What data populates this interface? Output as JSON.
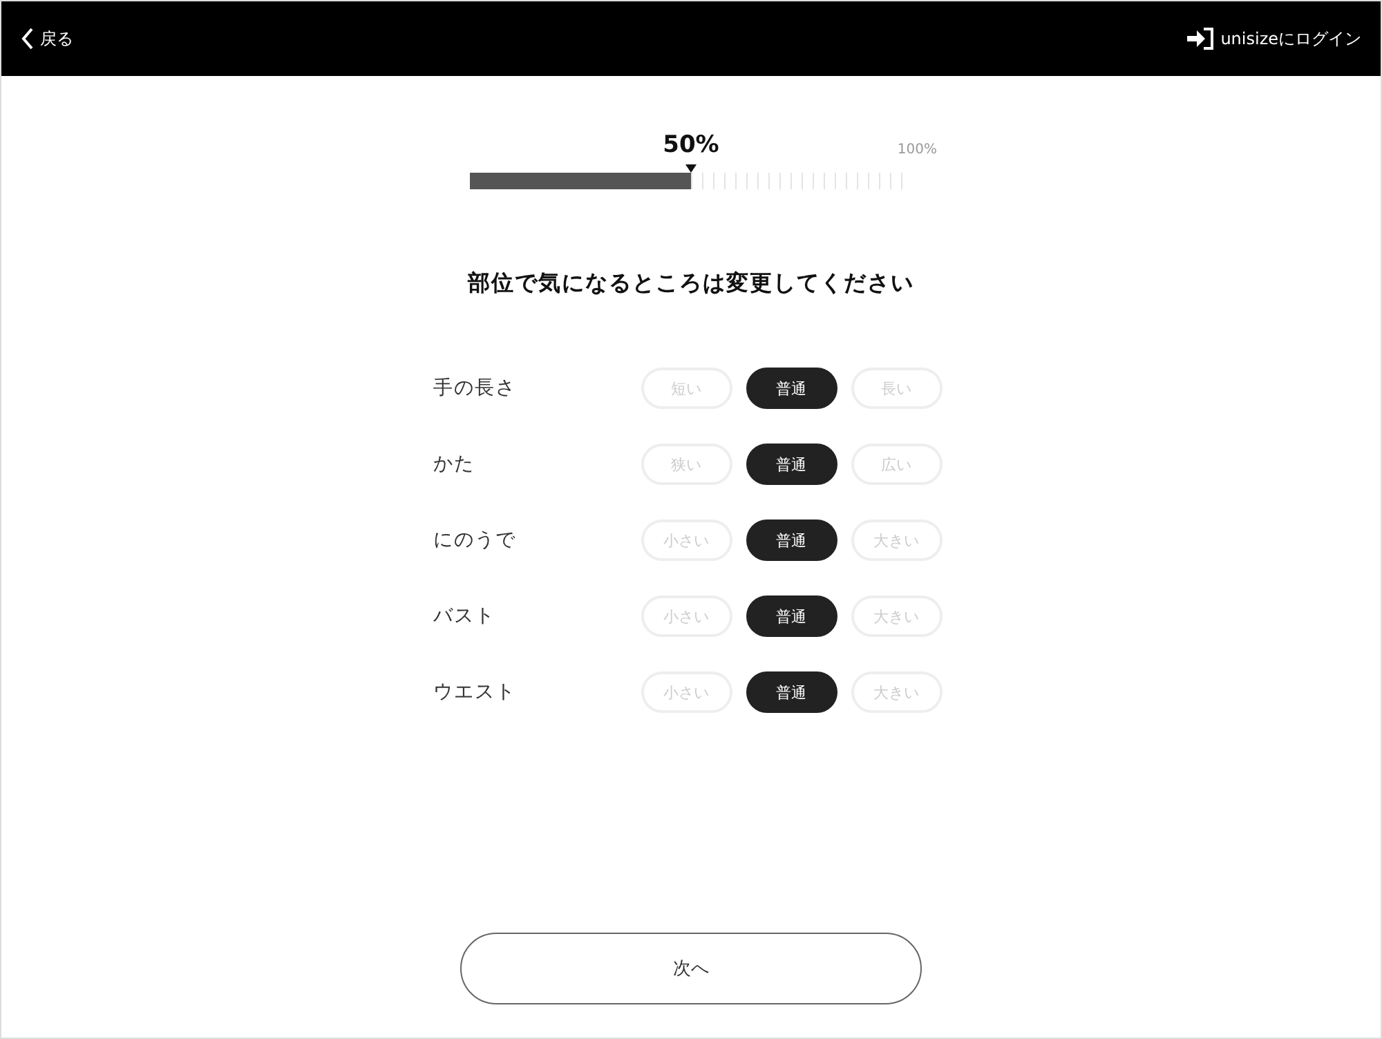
{
  "header": {
    "back_label": "戻る",
    "login_label": "unisizeにログイン"
  },
  "progress": {
    "level": 0.5,
    "reading": "50%",
    "max_label": "100%"
  },
  "heading": "部位で気になるところは変更してください",
  "rows": [
    {
      "label": "手の長さ",
      "options": [
        {
          "label": "短い",
          "selected": false
        },
        {
          "label": "普通",
          "selected": true
        },
        {
          "label": "長い",
          "selected": false
        }
      ]
    },
    {
      "label": "かた",
      "options": [
        {
          "label": "狭い",
          "selected": false
        },
        {
          "label": "普通",
          "selected": true
        },
        {
          "label": "広い",
          "selected": false
        }
      ]
    },
    {
      "label": "にのうで",
      "options": [
        {
          "label": "小さい",
          "selected": false
        },
        {
          "label": "普通",
          "selected": true
        },
        {
          "label": "大きい",
          "selected": false
        }
      ]
    },
    {
      "label": "バスト",
      "options": [
        {
          "label": "小さい",
          "selected": false
        },
        {
          "label": "普通",
          "selected": true
        },
        {
          "label": "大きい",
          "selected": false
        }
      ]
    },
    {
      "label": "ウエスト",
      "options": [
        {
          "label": "小さい",
          "selected": false
        },
        {
          "label": "普通",
          "selected": true
        },
        {
          "label": "大きい",
          "selected": false
        }
      ]
    }
  ],
  "next_button": "次へ"
}
